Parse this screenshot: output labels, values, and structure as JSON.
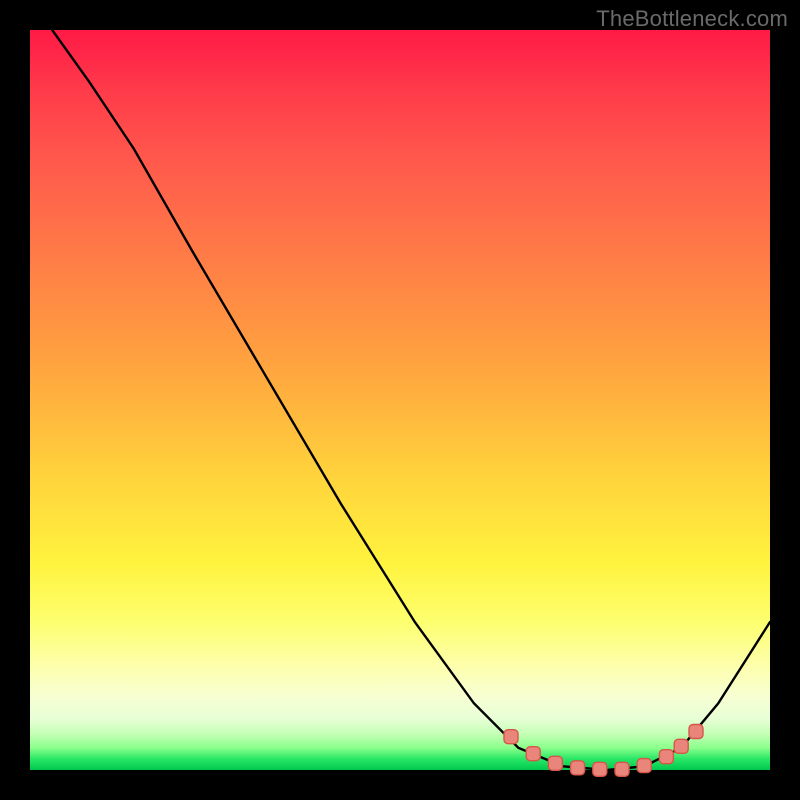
{
  "watermark": "TheBottleneck.com",
  "chart_data": {
    "type": "line",
    "title": "",
    "xlabel": "",
    "ylabel": "",
    "xlim": [
      0,
      100
    ],
    "ylim": [
      0,
      100
    ],
    "grid": false,
    "legend": false,
    "series": [
      {
        "name": "curve",
        "color": "#000000",
        "points": [
          {
            "x": 3,
            "y": 100
          },
          {
            "x": 8,
            "y": 93
          },
          {
            "x": 14,
            "y": 84
          },
          {
            "x": 22,
            "y": 70
          },
          {
            "x": 32,
            "y": 53
          },
          {
            "x": 42,
            "y": 36
          },
          {
            "x": 52,
            "y": 20
          },
          {
            "x": 60,
            "y": 9
          },
          {
            "x": 66,
            "y": 3
          },
          {
            "x": 72,
            "y": 0.5
          },
          {
            "x": 78,
            "y": 0
          },
          {
            "x": 83,
            "y": 0.5
          },
          {
            "x": 88,
            "y": 3
          },
          {
            "x": 93,
            "y": 9
          },
          {
            "x": 100,
            "y": 20
          }
        ]
      }
    ],
    "markers": {
      "name": "highlighted-points",
      "color": "#e9857b",
      "stroke": "#d6574a",
      "shape": "rounded-square",
      "points": [
        {
          "x": 65,
          "y": 4.5
        },
        {
          "x": 68,
          "y": 2.2
        },
        {
          "x": 71,
          "y": 0.9
        },
        {
          "x": 74,
          "y": 0.3
        },
        {
          "x": 77,
          "y": 0.1
        },
        {
          "x": 80,
          "y": 0.1
        },
        {
          "x": 83,
          "y": 0.6
        },
        {
          "x": 86,
          "y": 1.8
        },
        {
          "x": 88,
          "y": 3.2
        },
        {
          "x": 90,
          "y": 5.2
        }
      ]
    },
    "gradient_stops": [
      {
        "pct": 0,
        "color": "#ff1a46"
      },
      {
        "pct": 18,
        "color": "#ff5a4c"
      },
      {
        "pct": 45,
        "color": "#ffa33f"
      },
      {
        "pct": 72,
        "color": "#fff33e"
      },
      {
        "pct": 90,
        "color": "#f7ffd2"
      },
      {
        "pct": 100,
        "color": "#00c84e"
      }
    ]
  }
}
